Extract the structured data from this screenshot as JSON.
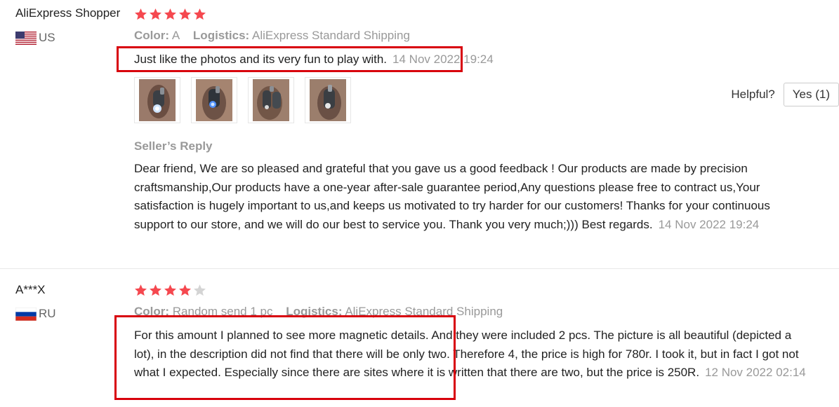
{
  "reviews": [
    {
      "user": "AliExpress Shopper",
      "country": "US",
      "rating": 5,
      "color_label": "Color:",
      "color_value": "A",
      "logistics_label": "Logistics:",
      "logistics_value": "AliExpress Standard Shipping",
      "text": "Just like the photos and its very fun to play with.",
      "date": "14 Nov 2022 19:24",
      "photo_count": 4,
      "helpful_label": "Helpful?",
      "helpful_button": "Yes (1)",
      "seller_reply_title": "Seller’s Reply",
      "seller_reply_text": "Dear friend, We are so pleased and grateful that you gave us a good feedback ! Our products are made by precision craftsmanship,Our products have a one-year after-sale guarantee period,Any questions please free to contract us,Your satisfaction is hugely important to us,and keeps us motivated to try harder for our customers! Thanks for your continuous support to our store, and we will do our best to service you. Thank you very much;))) Best regards.",
      "seller_reply_date": "14 Nov 2022 19:24"
    },
    {
      "user": "A***X",
      "country": "RU",
      "rating": 4,
      "color_label": "Color:",
      "color_value": "Random send 1 pc",
      "logistics_label": "Logistics:",
      "logistics_value": "AliExpress Standard Shipping",
      "text": "For this amount I planned to see more magnetic details. And they were included 2 pcs. The picture is all beautiful (depicted a lot), in the description did not find that there will be only two. Therefore 4, the price is high for 780r. I took it, but in fact I got not what I expected. Especially since there are sites where it is written that there are two, but the price is 250R.",
      "date": "12 Nov 2022 02:14"
    }
  ],
  "colors": {
    "star_filled": "#f5484f",
    "star_empty": "#d4d4d4",
    "highlight": "#d8000c"
  }
}
